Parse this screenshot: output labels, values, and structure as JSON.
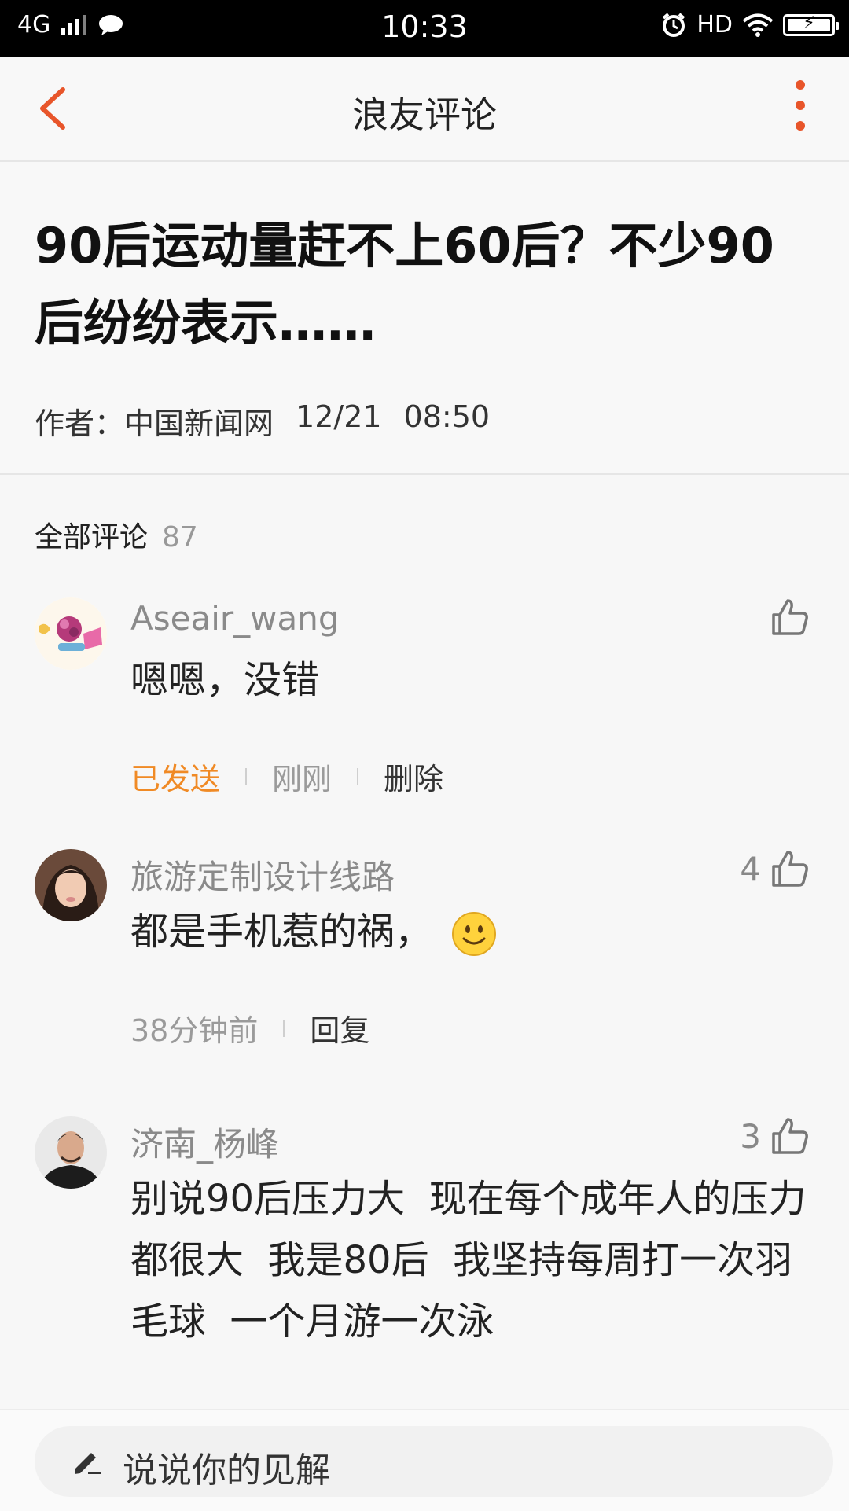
{
  "status_bar": {
    "network": "4G",
    "time": "10:33",
    "hd_label": "HD",
    "icons": [
      "signal-bars-icon",
      "chat-bubble-icon",
      "alarm-icon",
      "wifi-icon",
      "battery-charging-icon"
    ]
  },
  "nav": {
    "title": "浪友评论",
    "back_icon": "chevron-left-icon",
    "more_icon": "more-vertical-icon",
    "accent": "#e8552a"
  },
  "article": {
    "headline": "90后运动量赶不上60后？不少90后纷纷表示……",
    "author_label": "作者：",
    "author": "中国新闻网",
    "date": "12/21",
    "time": "08:50"
  },
  "comments_section": {
    "label": "全部评论",
    "count": "87"
  },
  "comments": [
    {
      "username": "Aseair_wang",
      "body": "嗯嗯，没错",
      "like_count": "",
      "status": "已发送",
      "time": "刚刚",
      "action": "删除"
    },
    {
      "username": "旅游定制设计线路",
      "body": "都是手机惹的祸，",
      "emoji": "smiley-face-icon",
      "like_count": "4",
      "time": "38分钟前",
      "action": "回复"
    },
    {
      "username": "济南_杨峰",
      "body": "别说90后压力大  现在每个成年人的压力都很大  我是80后  我坚持每周打一次羽毛球  一个月游一次泳",
      "like_count": "3"
    }
  ],
  "composer": {
    "placeholder": "说说你的见解",
    "icon": "pencil-icon"
  },
  "colors": {
    "accent_orange": "#f08a25",
    "accent_red": "#e8552a"
  }
}
